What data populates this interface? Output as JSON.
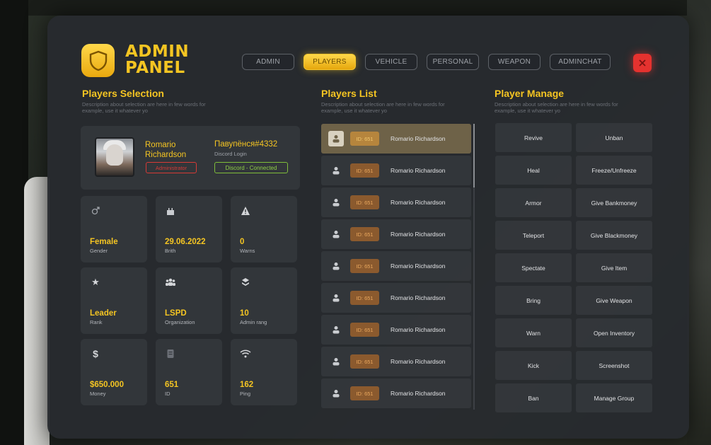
{
  "header": {
    "logo_line1": "ADMIN",
    "logo_line2": "PANEL",
    "tabs": [
      "ADMIN",
      "PLAYERS",
      "VEHICLE",
      "PERSONAL",
      "WEAPON",
      "ADMINCHAT"
    ],
    "active_tab": "PLAYERS",
    "close_label": "✕"
  },
  "selection": {
    "title": "Players Selection",
    "desc": "Description about selection are here in few words for example, use it whatever yo",
    "player_name_1": "Romario",
    "player_name_2": "Richardson",
    "role_badge": "Administrator",
    "discord_name": "Павупёнся#4332",
    "discord_sub": "Discord Login",
    "discord_status": "Discord - Connected",
    "stats": [
      {
        "icon": "gender-icon",
        "value": "Female",
        "label": "Gender"
      },
      {
        "icon": "cake-icon",
        "value": "29.06.2022",
        "label": "Brith"
      },
      {
        "icon": "warning-icon",
        "value": "0",
        "label": "Warns"
      },
      {
        "icon": "star-icon",
        "value": "Leader",
        "label": "Rank"
      },
      {
        "icon": "group-icon",
        "value": "LSPD",
        "label": "Organization"
      },
      {
        "icon": "stack-icon",
        "value": "10",
        "label": "Admin rang"
      },
      {
        "icon": "dollar-icon",
        "value": "$650.000",
        "label": "Money"
      },
      {
        "icon": "id-icon",
        "value": "651",
        "label": "ID"
      },
      {
        "icon": "wifi-icon",
        "value": "162",
        "label": "Ping"
      }
    ]
  },
  "list": {
    "title": "Players List",
    "desc": "Description about selection are here in few words for example, use it whatever yo",
    "rows": [
      {
        "id": "ID: 651",
        "name": "Romario Richardson",
        "selected": true
      },
      {
        "id": "ID: 651",
        "name": "Romario Richardson",
        "selected": false
      },
      {
        "id": "ID: 651",
        "name": "Romario Richardson",
        "selected": false
      },
      {
        "id": "ID: 651",
        "name": "Romario Richardson",
        "selected": false
      },
      {
        "id": "ID: 651",
        "name": "Romario Richardson",
        "selected": false
      },
      {
        "id": "ID: 651",
        "name": "Romario Richardson",
        "selected": false
      },
      {
        "id": "ID: 651",
        "name": "Romario Richardson",
        "selected": false
      },
      {
        "id": "ID: 651",
        "name": "Romario Richardson",
        "selected": false
      },
      {
        "id": "ID: 651",
        "name": "Romario Richardson",
        "selected": false
      }
    ]
  },
  "manage": {
    "title": "Player Manage",
    "desc": "Description about selection are here in few words for example, use it whatever yo",
    "buttons": [
      "Revive",
      "Unban",
      "Heal",
      "Freeze/Unfreeze",
      "Armor",
      "Give Bankmoney",
      "Teleport",
      "Give Blackmoney",
      "Spectate",
      "Give Item",
      "Bring",
      "Give Weapon",
      "Warn",
      "Open Inventory",
      "Kick",
      "Screenshot",
      "Ban",
      "Manage Group"
    ]
  },
  "colors": {
    "accent": "#f5c522",
    "close": "#e5322f",
    "danger": "#d63a36",
    "success": "#8fcf46"
  }
}
